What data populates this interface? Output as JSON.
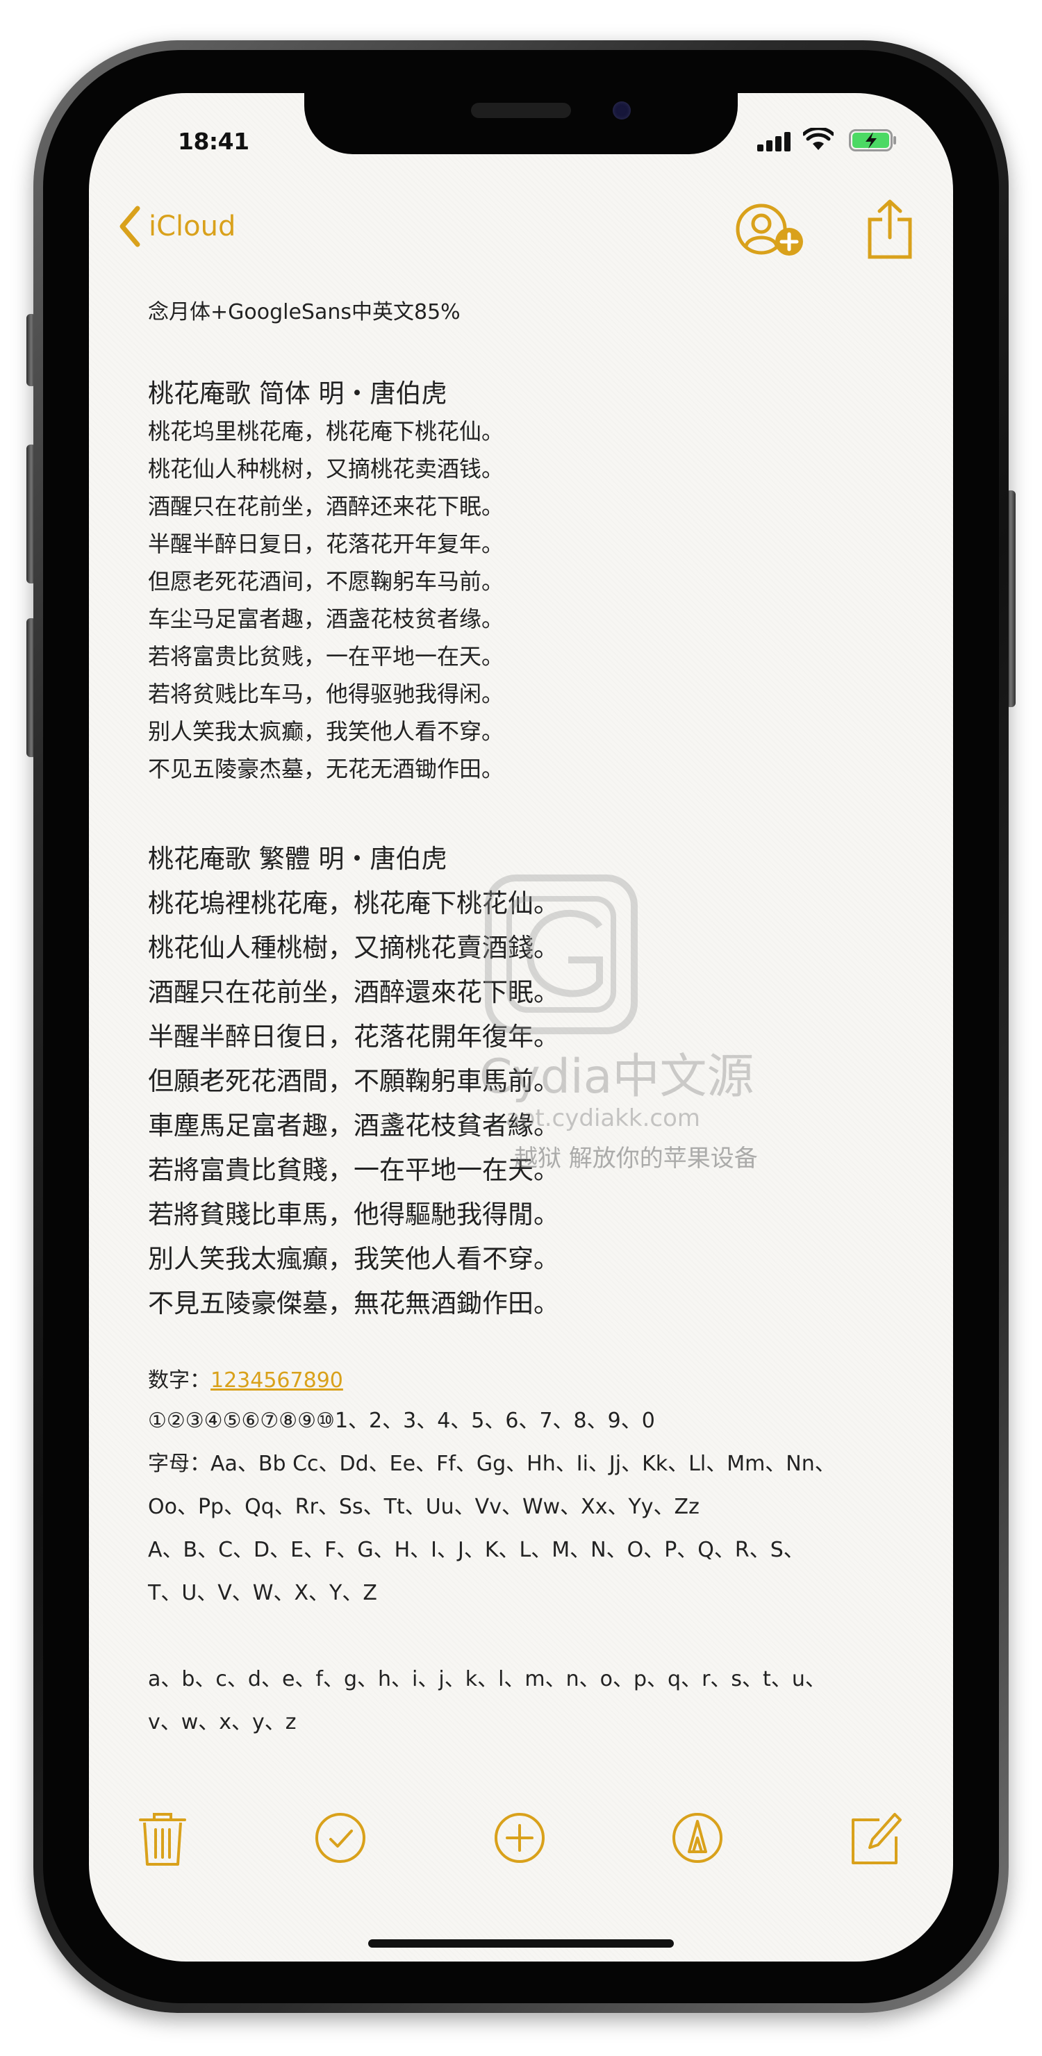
{
  "status_bar": {
    "time": "18:41"
  },
  "nav": {
    "back_label": "iCloud"
  },
  "note": {
    "title": "念月体+GoogleSans中英文85%",
    "section1": {
      "heading": "桃花庵歌  简体   明・唐伯虎",
      "lines": [
        "桃花坞里桃花庵，桃花庵下桃花仙。",
        "桃花仙人种桃树，又摘桃花卖酒钱。",
        "酒醒只在花前坐，酒醉还来花下眠。",
        "半醒半醉日复日，花落花开年复年。",
        "但愿老死花酒间，不愿鞠躬车马前。",
        "车尘马足富者趣，酒盏花枝贫者缘。",
        "若将富贵比贫贱，一在平地一在天。",
        "若将贫贱比车马，他得驱驰我得闲。",
        "别人笑我太疯癫，我笑他人看不穿。",
        "不见五陵豪杰墓，无花无酒锄作田。"
      ]
    },
    "section2": {
      "heading": "桃花庵歌  繁體      明・唐伯虎",
      "lines": [
        "桃花塢裡桃花庵，桃花庵下桃花仙。",
        "桃花仙人種桃樹，又摘桃花賣酒錢。",
        "酒醒只在花前坐，酒醉還來花下眠。",
        "半醒半醉日復日，花落花開年復年。",
        "但願老死花酒間，不願鞠躬車馬前。",
        "車塵馬足富者趣，酒盞花枝貧者緣。",
        "若將富貴比貧賤，一在平地一在天。",
        "若將貧賤比車馬，他得驅馳我得閒。",
        "別人笑我太瘋癲，我笑他人看不穿。",
        "不見五陵豪傑墓，無花無酒鋤作田。"
      ]
    },
    "numbers_label": "数字：",
    "numbers_link": "1234567890",
    "circled_numbers": "①②③④⑤⑥⑦⑧⑨⑩1、2、3、4、5、6、7、8、9、0",
    "letters_line1": "字母：Aa、Bb Cc、Dd、Ee、Ff、Gg、Hh、Ii、Jj、Kk、Ll、Mm、Nn、",
    "letters_line2": "Oo、Pp、Qq、Rr、Ss、Tt、Uu、Vv、Ww、Xx、Yy、Zz",
    "upper_line1": "A、B、C、D、E、F、G、H、I、J、K、L、M、N、O、P、Q、R、S、",
    "upper_line2": "T、U、V、W、X、Y、Z",
    "lower_line1": "a、b、c、d、e、f、g、h、i、j、k、l、m、n、o、p、q、r、s、t、u、",
    "lower_line2": "v、w、x、y、z"
  },
  "watermark": {
    "main": "Cydia中文源",
    "url": "apt.cydiakk.com",
    "slogan": "越狱  解放你的苹果设备"
  },
  "colors": {
    "accent": "#d9a11b",
    "text": "#222222",
    "paper": "#f7f6f3"
  },
  "icons": [
    "chevron-left-icon",
    "add-person-icon",
    "share-icon",
    "trash-icon",
    "checklist-icon",
    "add-icon",
    "markup-icon",
    "compose-icon"
  ]
}
